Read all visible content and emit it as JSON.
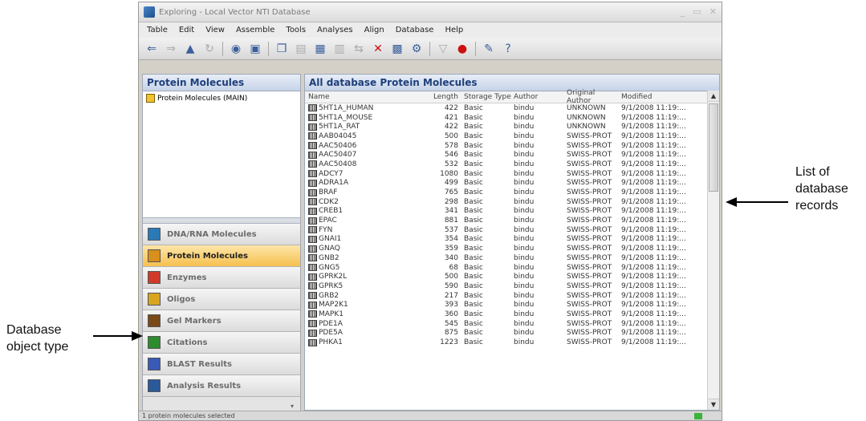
{
  "window": {
    "title": "Exploring - Local Vector NTI Database",
    "controls": [
      "_",
      "▭",
      "✕"
    ]
  },
  "menu": [
    "Table",
    "Edit",
    "View",
    "Assemble",
    "Tools",
    "Analyses",
    "Align",
    "Database",
    "Help"
  ],
  "left_panel": {
    "title": "Protein Molecules",
    "tree_item": "Protein Molecules (MAIN)",
    "nav": [
      {
        "label": "DNA/RNA Molecules",
        "icon": "dna-icon",
        "color": "#2a7ab8",
        "active": false
      },
      {
        "label": "Protein Molecules",
        "icon": "protein-icon",
        "color": "#d98f1c",
        "active": true
      },
      {
        "label": "Enzymes",
        "icon": "enzyme-icon",
        "color": "#d03a2a",
        "active": false
      },
      {
        "label": "Oligos",
        "icon": "oligo-icon",
        "color": "#d9a520",
        "active": false
      },
      {
        "label": "Gel Markers",
        "icon": "gel-icon",
        "color": "#7a4a1a",
        "active": false
      },
      {
        "label": "Citations",
        "icon": "citation-icon",
        "color": "#2e8b2e",
        "active": false
      },
      {
        "label": "BLAST Results",
        "icon": "blast-icon",
        "color": "#3a5ab8",
        "active": false
      },
      {
        "label": "Analysis Results",
        "icon": "analysis-icon",
        "color": "#2a5a9a",
        "active": false
      }
    ],
    "footer_glyph": "▾"
  },
  "right_panel": {
    "title": "All database Protein Molecules",
    "columns": [
      "Name",
      "Length",
      "Storage Type",
      "Author",
      "Original Author",
      "Modified"
    ],
    "rows": [
      [
        "5HT1A_HUMAN",
        "422",
        "Basic",
        "bindu",
        "UNKNOWN",
        "9/1/2008 11:19:..."
      ],
      [
        "5HT1A_MOUSE",
        "421",
        "Basic",
        "bindu",
        "UNKNOWN",
        "9/1/2008 11:19:..."
      ],
      [
        "5HT1A_RAT",
        "422",
        "Basic",
        "bindu",
        "UNKNOWN",
        "9/1/2008 11:19:..."
      ],
      [
        "AAB04045",
        "500",
        "Basic",
        "bindu",
        "SWISS-PROT",
        "9/1/2008 11:19:..."
      ],
      [
        "AAC50406",
        "578",
        "Basic",
        "bindu",
        "SWISS-PROT",
        "9/1/2008 11:19:..."
      ],
      [
        "AAC50407",
        "546",
        "Basic",
        "bindu",
        "SWISS-PROT",
        "9/1/2008 11:19:..."
      ],
      [
        "AAC50408",
        "532",
        "Basic",
        "bindu",
        "SWISS-PROT",
        "9/1/2008 11:19:..."
      ],
      [
        "ADCY7",
        "1080",
        "Basic",
        "bindu",
        "SWISS-PROT",
        "9/1/2008 11:19:..."
      ],
      [
        "ADRA1A",
        "499",
        "Basic",
        "bindu",
        "SWISS-PROT",
        "9/1/2008 11:19:..."
      ],
      [
        "BRAF",
        "765",
        "Basic",
        "bindu",
        "SWISS-PROT",
        "9/1/2008 11:19:..."
      ],
      [
        "CDK2",
        "298",
        "Basic",
        "bindu",
        "SWISS-PROT",
        "9/1/2008 11:19:..."
      ],
      [
        "CREB1",
        "341",
        "Basic",
        "bindu",
        "SWISS-PROT",
        "9/1/2008 11:19:..."
      ],
      [
        "EPAC",
        "881",
        "Basic",
        "bindu",
        "SWISS-PROT",
        "9/1/2008 11:19:..."
      ],
      [
        "FYN",
        "537",
        "Basic",
        "bindu",
        "SWISS-PROT",
        "9/1/2008 11:19:..."
      ],
      [
        "GNAI1",
        "354",
        "Basic",
        "bindu",
        "SWISS-PROT",
        "9/1/2008 11:19:..."
      ],
      [
        "GNAQ",
        "359",
        "Basic",
        "bindu",
        "SWISS-PROT",
        "9/1/2008 11:19:..."
      ],
      [
        "GNB2",
        "340",
        "Basic",
        "bindu",
        "SWISS-PROT",
        "9/1/2008 11:19:..."
      ],
      [
        "GNG5",
        "68",
        "Basic",
        "bindu",
        "SWISS-PROT",
        "9/1/2008 11:19:..."
      ],
      [
        "GPRK2L",
        "500",
        "Basic",
        "bindu",
        "SWISS-PROT",
        "9/1/2008 11:19:..."
      ],
      [
        "GPRK5",
        "590",
        "Basic",
        "bindu",
        "SWISS-PROT",
        "9/1/2008 11:19:..."
      ],
      [
        "GRB2",
        "217",
        "Basic",
        "bindu",
        "SWISS-PROT",
        "9/1/2008 11:19:..."
      ],
      [
        "MAP2K1",
        "393",
        "Basic",
        "bindu",
        "SWISS-PROT",
        "9/1/2008 11:19:..."
      ],
      [
        "MAPK1",
        "360",
        "Basic",
        "bindu",
        "SWISS-PROT",
        "9/1/2008 11:19:..."
      ],
      [
        "PDE1A",
        "545",
        "Basic",
        "bindu",
        "SWISS-PROT",
        "9/1/2008 11:19:..."
      ],
      [
        "PDE5A",
        "875",
        "Basic",
        "bindu",
        "SWISS-PROT",
        "9/1/2008 11:19:..."
      ],
      [
        "PHKA1",
        "1223",
        "Basic",
        "bindu",
        "SWISS-PROT",
        "9/1/2008 11:19:..."
      ]
    ]
  },
  "status": {
    "text": "1 protein molecules selected"
  },
  "callouts": {
    "records": [
      "List of",
      "database",
      "records"
    ],
    "object_type": [
      "Database",
      "object type"
    ]
  }
}
